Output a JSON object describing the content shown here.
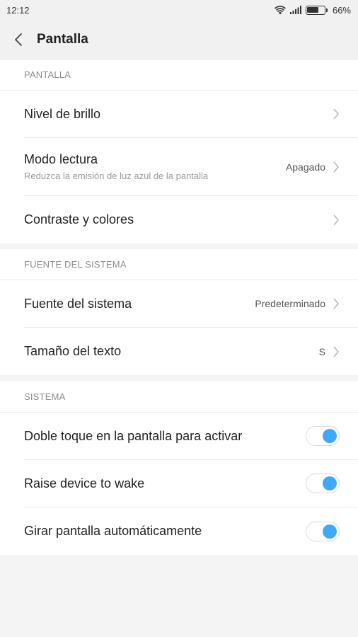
{
  "status_bar": {
    "time": "12:12",
    "battery_percent_label": "66%",
    "battery_level": 0.66,
    "icons": [
      "wifi-icon",
      "signal-icon",
      "battery-icon"
    ]
  },
  "top_bar": {
    "title": "Pantalla",
    "back_icon": "chevron-left-icon"
  },
  "colors": {
    "accent": "#3fa9f5",
    "section_label": "#8c8c8c",
    "background": "#f4f4f4"
  },
  "sections": [
    {
      "header": "PANTALLA",
      "items": [
        {
          "title": "Nivel de brillo"
        },
        {
          "title": "Modo lectura",
          "subtitle": "Reduzca la emisión de luz azul de la pantalla",
          "value": "Apagado"
        },
        {
          "title": "Contraste y colores"
        }
      ]
    },
    {
      "header": "FUENTE DEL SISTEMA",
      "items": [
        {
          "title": "Fuente del sistema",
          "value": "Predeterminado"
        },
        {
          "title": "Tamaño del texto",
          "value": "S"
        }
      ]
    },
    {
      "header": "SISTEMA",
      "items": [
        {
          "title": "Doble toque en la pantalla para activar",
          "toggle": true
        },
        {
          "title": "Raise device to wake",
          "toggle": true
        },
        {
          "title": "Girar pantalla automáticamente",
          "toggle": true
        }
      ]
    }
  ]
}
